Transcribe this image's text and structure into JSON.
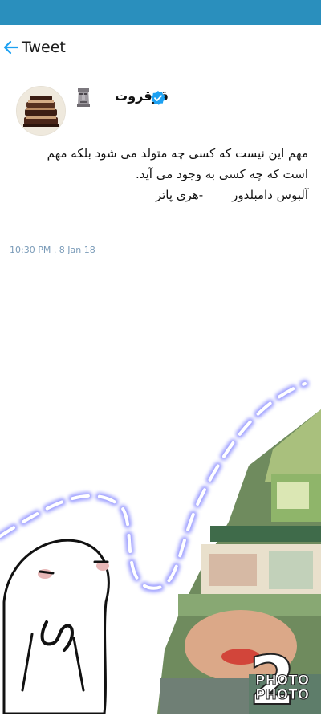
{
  "nav": {
    "title": "Tweet"
  },
  "user": {
    "name": "قرقروت"
  },
  "tweet": {
    "lines": [
      "مهم این نیست که کسی چه متولد می شود بلکه مهم",
      "است که چه کسی به وجود می آید."
    ],
    "quote_author": "آلبوس دامبلدور",
    "quote_source": "-هری پاتر",
    "timestamp": "10:30 PM . 8 Jan 18"
  },
  "watermark": {
    "number": "2",
    "line1": "PHOTO",
    "line2": "PHOTO"
  },
  "colors": {
    "status_bar": "#2a8fbd",
    "accent": "#1da1f2",
    "timestamp": "#7a9bb8"
  },
  "icons": {
    "back": "arrow-left-icon",
    "verified": "verified-badge-icon",
    "emoji": "moai-emoji-icon"
  }
}
